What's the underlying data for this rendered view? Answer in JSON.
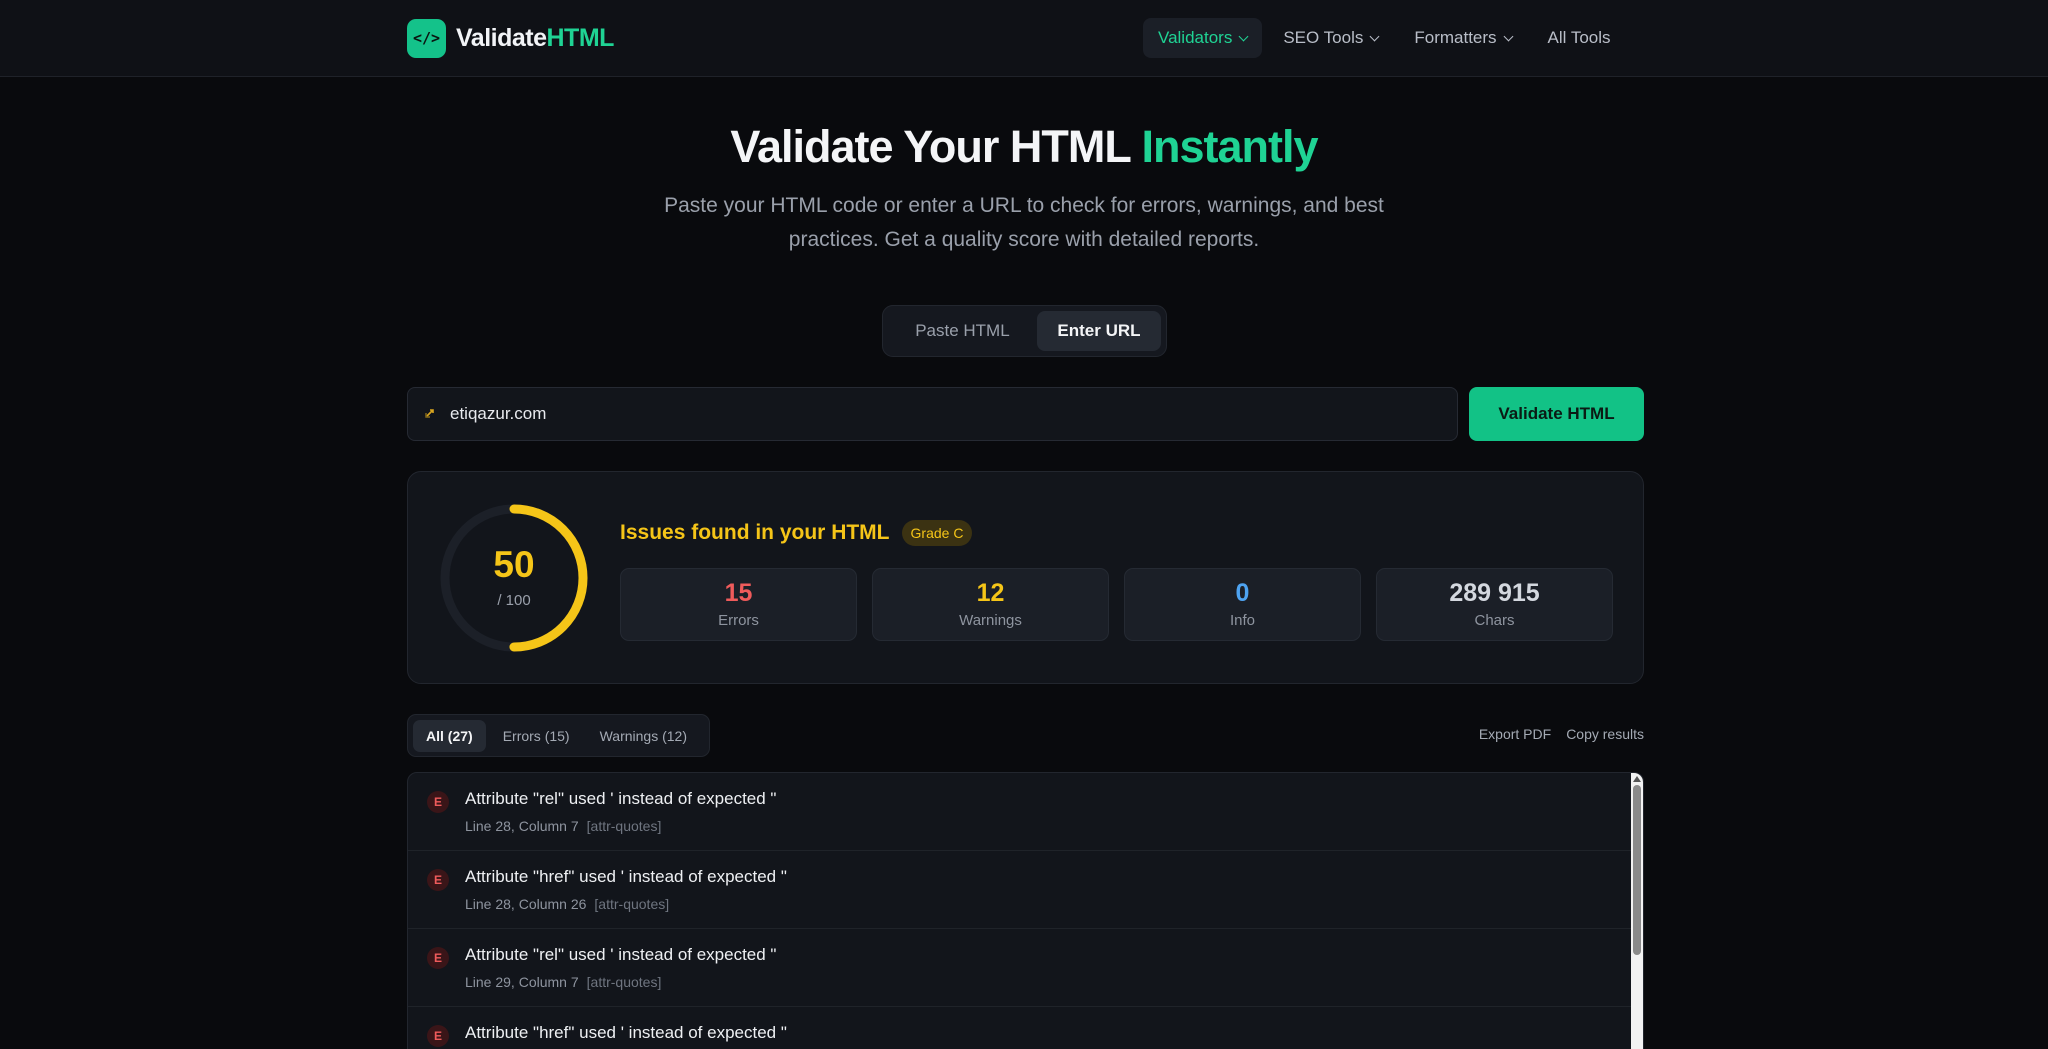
{
  "header": {
    "logo_badge": "</>",
    "logo_text_primary": "Validate",
    "logo_text_accent": "HTML",
    "nav": [
      {
        "label": "Validators",
        "dropdown": true,
        "active": true
      },
      {
        "label": "SEO Tools",
        "dropdown": true
      },
      {
        "label": "Formatters",
        "dropdown": true
      },
      {
        "label": "All Tools",
        "dropdown": false
      }
    ]
  },
  "hero": {
    "title_main": "Validate Your HTML ",
    "title_accent": "Instantly",
    "subtitle": "Paste your HTML code or enter a URL to check for errors, warnings, and best practices. Get a quality score with detailed reports."
  },
  "mode_toggle": {
    "paste_label": "Paste HTML",
    "url_label": "Enter URL",
    "selected": "Enter URL"
  },
  "url_form": {
    "icon": "link-icon",
    "value": "etiqazur.com",
    "button_label": "Validate HTML"
  },
  "results": {
    "score": "50",
    "score_max": "/ 100",
    "score_fraction": 0.5,
    "heading": "Issues found in your HTML",
    "grade": "Grade C",
    "stats": [
      {
        "value": "15",
        "label": "Errors",
        "color": "#ef5b5b"
      },
      {
        "value": "12",
        "label": "Warnings",
        "color": "#f5c518"
      },
      {
        "value": "0",
        "label": "Info",
        "color": "#4ea3f1"
      },
      {
        "value": "289 915",
        "label": "Chars",
        "color": "#d4d8df"
      }
    ]
  },
  "filters": {
    "all": "All (27)",
    "errors": "Errors (15)",
    "warnings": "Warnings (12)",
    "export": "Export PDF",
    "copy": "Copy results"
  },
  "issues": [
    {
      "type": "E",
      "message": "Attribute \"rel\" used ' instead of expected \"",
      "location": "Line 28, Column 7",
      "code": "[attr-quotes]"
    },
    {
      "type": "E",
      "message": "Attribute \"href\" used ' instead of expected \"",
      "location": "Line 28, Column 26",
      "code": "[attr-quotes]"
    },
    {
      "type": "E",
      "message": "Attribute \"rel\" used ' instead of expected \"",
      "location": "Line 29, Column 7",
      "code": "[attr-quotes]"
    },
    {
      "type": "E",
      "message": "Attribute \"href\" used ' instead of expected \"",
      "location": "",
      "code": ""
    }
  ],
  "colors": {
    "accent": "#1fd394",
    "warning": "#f5c518",
    "error": "#ef5b5b",
    "info": "#4ea3f1"
  }
}
